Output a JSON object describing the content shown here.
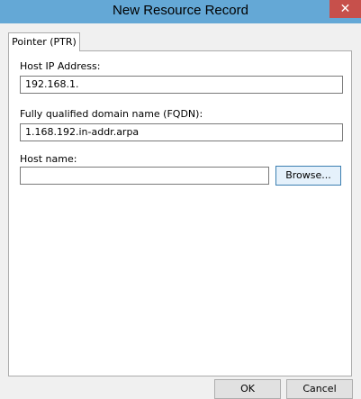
{
  "window": {
    "title": "New Resource Record",
    "close_glyph": "✕"
  },
  "tabs": [
    {
      "label": "Pointer (PTR)",
      "selected": true
    }
  ],
  "form": {
    "host_ip": {
      "label": "Host IP Address:",
      "value": "192.168.1."
    },
    "fqdn": {
      "label": "Fully qualified domain name (FQDN):",
      "value": "1.168.192.in-addr.arpa"
    },
    "host_name": {
      "label": "Host name:",
      "value": ""
    },
    "browse_label": "Browse..."
  },
  "buttons": {
    "ok_label": "OK",
    "cancel_label": "Cancel"
  },
  "colors": {
    "titlebar": "#64a8d6",
    "close_button": "#c7504b",
    "dialog_background": "#f0f0f0"
  }
}
